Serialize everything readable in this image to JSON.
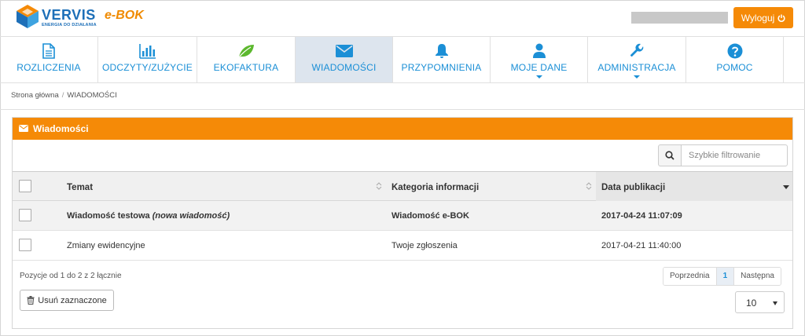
{
  "header": {
    "brand": "VERVIS",
    "brand_sub": "ENERGIA DO DZIAŁANIA",
    "product": "e-BOK",
    "logout_label": "Wyloguj"
  },
  "nav": {
    "items": [
      {
        "label": "ROZLICZENIA",
        "icon": "document-icon"
      },
      {
        "label": "ODCZYTY/ZUŻYCIE",
        "icon": "bar-chart-icon"
      },
      {
        "label": "EKOFAKTURA",
        "icon": "leaf-icon"
      },
      {
        "label": "WIADOMOŚCI",
        "icon": "envelope-icon",
        "active": true
      },
      {
        "label": "PRZYPOMNIENIA",
        "icon": "bell-icon"
      },
      {
        "label": "MOJE DANE",
        "icon": "user-icon"
      },
      {
        "label": "ADMINISTRACJA",
        "icon": "wrench-icon"
      },
      {
        "label": "POMOC",
        "icon": "question-icon"
      }
    ]
  },
  "breadcrumb": {
    "home": "Strona główna",
    "current": "WIADOMOŚCI"
  },
  "panel": {
    "title": "Wiadomości"
  },
  "search": {
    "placeholder": "Szybkie filtrowanie"
  },
  "table": {
    "columns": [
      "Temat",
      "Kategoria informacji",
      "Data publikacji"
    ],
    "rows": [
      {
        "subject": "Wiadomość testowa",
        "subject_note": "(nowa wiadomość)",
        "category": "Wiadomość e-BOK",
        "date": "2017-04-24 11:07:09"
      },
      {
        "subject": "Zmiany ewidencyjne",
        "subject_note": "",
        "category": "Twoje zgłoszenia",
        "date": "2017-04-21 11:40:00"
      }
    ]
  },
  "footer": {
    "info": "Pozycje od 1 do 2 z 2 łącznie",
    "prev_label": "Poprzednia",
    "current_page": "1",
    "next_label": "Następna",
    "delete_label": "Usuń zaznaczone",
    "page_size": "10"
  },
  "colors": {
    "accent": "#f58a07",
    "nav_blue": "#1b8fd6",
    "brand_blue": "#1d6fb8"
  }
}
